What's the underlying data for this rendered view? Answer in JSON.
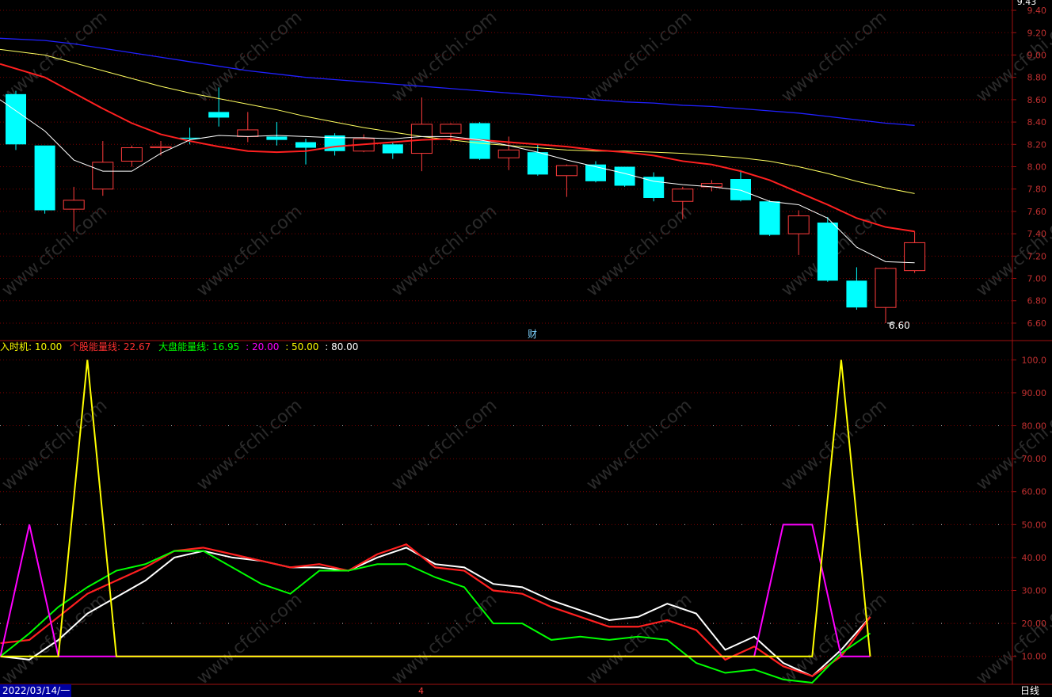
{
  "watermark": "www.cfchi.com",
  "price_panel": {
    "top_label": "9.43",
    "low_label": "6.60",
    "center_label": "财",
    "ticks": [
      "9.40",
      "9.20",
      "9.00",
      "8.80",
      "8.60",
      "8.40",
      "8.20",
      "8.00",
      "7.80",
      "7.60",
      "7.40",
      "7.20",
      "7.00",
      "6.80",
      "6.60"
    ]
  },
  "indicator_panel": {
    "legend": [
      {
        "text": "入时机: 10.00",
        "color": "#ffff00"
      },
      {
        "text": "个股能量线: 22.67",
        "color": "#ff3030"
      },
      {
        "text": "大盘能量线: 16.95",
        "color": "#00ff00"
      },
      {
        "text": ": 20.00",
        "color": "#ff00ff"
      },
      {
        "text": ": 50.00",
        "color": "#ffff00"
      },
      {
        "text": ": 80.00",
        "color": "#ffffff"
      }
    ],
    "ticks": [
      "100.0",
      "90.00",
      "80.00",
      "70.00",
      "60.00",
      "50.00",
      "40.00",
      "30.00",
      "20.00",
      "10.00"
    ]
  },
  "bottom_bar": {
    "date": "2022/03/14/一",
    "marker": "4",
    "period": "日线"
  },
  "colors": {
    "grid": "#7a0000",
    "axis": "#a01010",
    "tick_text": "#c03030",
    "up_candle": "#ff3c3c",
    "down_candle": "#00ffff",
    "ma5": "#ffffff",
    "ma10": "#ff2020",
    "ma20": "#ffff60",
    "ma60": "#2020ff"
  },
  "chart_data": [
    {
      "type": "candlestick",
      "ylim": [
        6.55,
        9.45
      ],
      "candles": [
        {
          "o": 8.65,
          "c": 8.2,
          "h": 8.68,
          "l": 8.15
        },
        {
          "o": 8.19,
          "c": 7.61,
          "h": 8.19,
          "l": 7.58
        },
        {
          "o": 7.62,
          "c": 7.7,
          "h": 7.82,
          "l": 7.42
        },
        {
          "o": 7.8,
          "c": 8.04,
          "h": 8.23,
          "l": 7.74
        },
        {
          "o": 8.05,
          "c": 8.17,
          "h": 8.19,
          "l": 8.0
        },
        {
          "o": 8.17,
          "c": 8.18,
          "h": 8.23,
          "l": 8.1
        },
        {
          "o": 8.26,
          "c": 8.25,
          "h": 8.35,
          "l": 8.2
        },
        {
          "o": 8.49,
          "c": 8.44,
          "h": 8.71,
          "l": 8.36
        },
        {
          "o": 8.27,
          "c": 8.33,
          "h": 8.49,
          "l": 8.22
        },
        {
          "o": 8.27,
          "c": 8.24,
          "h": 8.4,
          "l": 8.19
        },
        {
          "o": 8.22,
          "c": 8.17,
          "h": 8.25,
          "l": 8.02
        },
        {
          "o": 8.28,
          "c": 8.14,
          "h": 8.3,
          "l": 8.1
        },
        {
          "o": 8.14,
          "c": 8.25,
          "h": 8.29,
          "l": 8.13
        },
        {
          "o": 8.2,
          "c": 8.12,
          "h": 8.22,
          "l": 8.07
        },
        {
          "o": 8.12,
          "c": 8.38,
          "h": 8.62,
          "l": 7.96
        },
        {
          "o": 8.3,
          "c": 8.38,
          "h": 8.39,
          "l": 8.22
        },
        {
          "o": 8.39,
          "c": 8.07,
          "h": 8.4,
          "l": 8.06
        },
        {
          "o": 8.08,
          "c": 8.15,
          "h": 8.27,
          "l": 7.97
        },
        {
          "o": 8.13,
          "c": 7.93,
          "h": 8.2,
          "l": 7.92
        },
        {
          "o": 7.92,
          "c": 8.01,
          "h": 8.02,
          "l": 7.73
        },
        {
          "o": 8.02,
          "c": 7.87,
          "h": 8.05,
          "l": 7.86
        },
        {
          "o": 8.0,
          "c": 7.83,
          "h": 8.0,
          "l": 7.82
        },
        {
          "o": 7.91,
          "c": 7.72,
          "h": 7.95,
          "l": 7.69
        },
        {
          "o": 7.69,
          "c": 7.8,
          "h": 7.82,
          "l": 7.53
        },
        {
          "o": 7.82,
          "c": 7.85,
          "h": 7.88,
          "l": 7.78
        },
        {
          "o": 7.89,
          "c": 7.7,
          "h": 7.97,
          "l": 7.69
        },
        {
          "o": 7.69,
          "c": 7.39,
          "h": 7.7,
          "l": 7.38
        },
        {
          "o": 7.4,
          "c": 7.56,
          "h": 7.61,
          "l": 7.21
        },
        {
          "o": 7.5,
          "c": 6.98,
          "h": 7.55,
          "l": 6.97
        },
        {
          "o": 6.98,
          "c": 6.74,
          "h": 7.1,
          "l": 6.72
        },
        {
          "o": 6.74,
          "c": 7.09,
          "h": 7.1,
          "l": 6.6
        },
        {
          "o": 7.07,
          "c": 7.32,
          "h": 7.42,
          "l": 7.05
        }
      ],
      "ma5": [
        8.6,
        8.32,
        8.06,
        7.96,
        7.96,
        8.12,
        8.24,
        8.28,
        8.27,
        8.28,
        8.27,
        8.26,
        8.26,
        8.25,
        8.27,
        8.27,
        8.24,
        8.19,
        8.13,
        8.06,
        8.0,
        7.94,
        7.87,
        7.84,
        7.82,
        7.79,
        7.69,
        7.66,
        7.54,
        7.28,
        7.15,
        7.14
      ],
      "ma10": [
        8.92,
        8.8,
        8.66,
        8.52,
        8.39,
        8.29,
        8.23,
        8.18,
        8.14,
        8.13,
        8.14,
        8.18,
        8.2,
        8.22,
        8.24,
        8.25,
        8.24,
        8.22,
        8.2,
        8.18,
        8.15,
        8.13,
        8.1,
        8.05,
        8.02,
        7.96,
        7.88,
        7.77,
        7.66,
        7.54,
        7.46,
        7.42
      ],
      "ma20": [
        9.05,
        9.0,
        8.93,
        8.86,
        8.79,
        8.72,
        8.66,
        8.61,
        8.56,
        8.51,
        8.45,
        8.4,
        8.35,
        8.31,
        8.27,
        8.24,
        8.21,
        8.19,
        8.17,
        8.15,
        8.14,
        8.14,
        8.13,
        8.12,
        8.1,
        8.08,
        8.05,
        8.0,
        7.94,
        7.87,
        7.81,
        7.76
      ],
      "ma60": [
        9.15,
        9.13,
        9.1,
        9.06,
        9.02,
        8.98,
        8.94,
        8.9,
        8.86,
        8.83,
        8.8,
        8.78,
        8.76,
        8.74,
        8.72,
        8.7,
        8.68,
        8.66,
        8.64,
        8.62,
        8.6,
        8.58,
        8.57,
        8.55,
        8.54,
        8.52,
        8.5,
        8.48,
        8.45,
        8.42,
        8.39,
        8.37
      ]
    },
    {
      "type": "line",
      "ylim": [
        2,
        102
      ],
      "reference_lines": [
        20,
        50,
        80
      ],
      "series": [
        {
          "name": "入时机",
          "color": "#ffff00",
          "values": [
            10,
            10,
            10,
            100,
            10,
            10,
            10,
            10,
            10,
            10,
            10,
            10,
            10,
            10,
            10,
            10,
            10,
            10,
            10,
            10,
            10,
            10,
            10,
            10,
            10,
            10,
            10,
            10,
            10,
            100,
            10
          ]
        },
        {
          "name": "个股能量线",
          "color": "#ff2020",
          "values": [
            14,
            15,
            22,
            29,
            33,
            37,
            42,
            43,
            41,
            39,
            37,
            38,
            36,
            41,
            44,
            37,
            36,
            30,
            29,
            25,
            22,
            19,
            19,
            21,
            18,
            9,
            13,
            7,
            4,
            10,
            22
          ]
        },
        {
          "name": "大盘能量线",
          "color": "#00ff00",
          "values": [
            10,
            17,
            25,
            31,
            36,
            38,
            42,
            42,
            37,
            32,
            29,
            36,
            36,
            38,
            38,
            34,
            31,
            20,
            20,
            15,
            16,
            15,
            16,
            15,
            8,
            5,
            6,
            3,
            2,
            11,
            17
          ]
        },
        {
          "name": "",
          "color": "#ff00ff",
          "values": [
            10,
            50,
            10,
            10,
            10,
            10,
            10,
            10,
            10,
            10,
            10,
            10,
            10,
            10,
            10,
            10,
            10,
            10,
            10,
            10,
            10,
            10,
            10,
            10,
            10,
            10,
            10,
            50,
            50,
            10,
            10
          ]
        },
        {
          "name": "",
          "color": "#ffffff",
          "values": [
            10,
            9,
            15,
            23,
            28,
            33,
            40,
            42,
            40,
            39,
            37,
            37,
            36,
            40,
            43,
            38,
            37,
            32,
            31,
            27,
            24,
            21,
            22,
            26,
            23,
            12,
            16,
            8,
            4,
            12,
            22
          ]
        }
      ]
    }
  ]
}
